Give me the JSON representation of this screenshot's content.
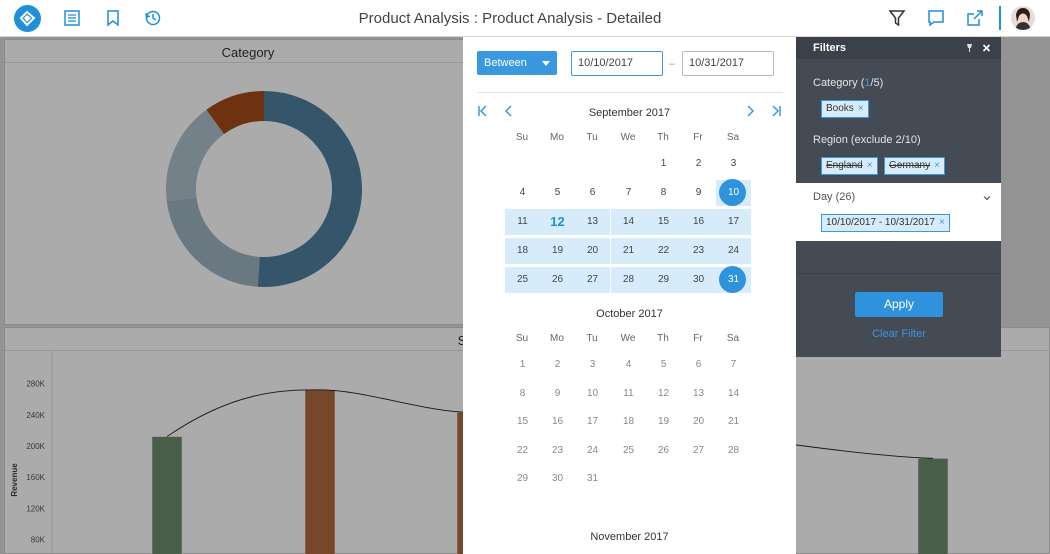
{
  "header": {
    "title": "Product Analysis : Product Analysis - Detailed"
  },
  "colors": {
    "accent": "#1f8fd8",
    "donut_main": "#4f7f9f",
    "donut_light": "#8da7b7",
    "donut_orange": "#a64b18",
    "bar_green": "#6e8b6e",
    "bar_orange": "#b06a3f"
  },
  "dashboard": {
    "category_title": "Category",
    "chart2_title_fragment": "S",
    "ylabel": "Revenue",
    "yticks": [
      "280K",
      "240K",
      "200K",
      "160K",
      "120K",
      "80K"
    ]
  },
  "chart_data": [
    {
      "type": "pie",
      "title": "Category",
      "donut": true,
      "values": [
        0.51,
        0.22,
        0.17,
        0.1
      ]
    },
    {
      "type": "bar",
      "ylabel": "Revenue",
      "ylim": [
        60000,
        300000
      ],
      "values": [
        212000,
        272000,
        243000,
        184000
      ],
      "line": true,
      "grid": false
    }
  ],
  "calendar": {
    "mode": "Between",
    "start": "10/10/2017",
    "separator": "–",
    "end": "10/31/2017",
    "weekdays": [
      "Su",
      "Mo",
      "Tu",
      "We",
      "Th",
      "Fr",
      "Sa"
    ],
    "months": [
      {
        "name": "September 2017",
        "weeks": [
          [
            "",
            "",
            "",
            "",
            "1",
            "2",
            "3"
          ],
          [
            "4",
            "5",
            "6",
            "7",
            "8",
            "9",
            "10"
          ],
          [
            "11",
            "12",
            "13",
            "14",
            "15",
            "16",
            "17"
          ],
          [
            "18",
            "19",
            "20",
            "21",
            "22",
            "23",
            "24"
          ],
          [
            "25",
            "26",
            "27",
            "28",
            "29",
            "30",
            "31"
          ]
        ]
      },
      {
        "name": "October 2017",
        "weeks": [
          [
            "1",
            "2",
            "3",
            "4",
            "5",
            "6",
            "7"
          ],
          [
            "8",
            "9",
            "10",
            "11",
            "12",
            "13",
            "14"
          ],
          [
            "15",
            "16",
            "17",
            "18",
            "19",
            "20",
            "21"
          ],
          [
            "22",
            "23",
            "24",
            "25",
            "26",
            "27",
            "28"
          ],
          [
            "29",
            "30",
            "31",
            "",
            "",
            "",
            ""
          ]
        ]
      },
      {
        "name": "November 2017",
        "weeks": []
      }
    ],
    "nav": {
      "first": "|<",
      "prev": "<",
      "next": ">",
      "last": ">|"
    }
  },
  "filters": {
    "title": "Filters",
    "category_prefix": "Category (",
    "category_count": "1",
    "category_suffix": "/5)",
    "category_chip": "Books",
    "region_label": "Region (exclude 2/10)",
    "region_chips": [
      "England",
      "Germany"
    ],
    "day_label": "Day (26)",
    "day_chip": "10/10/2017 - 10/31/2017",
    "apply": "Apply",
    "clear": "Clear Filter",
    "chip_remove": "×"
  }
}
